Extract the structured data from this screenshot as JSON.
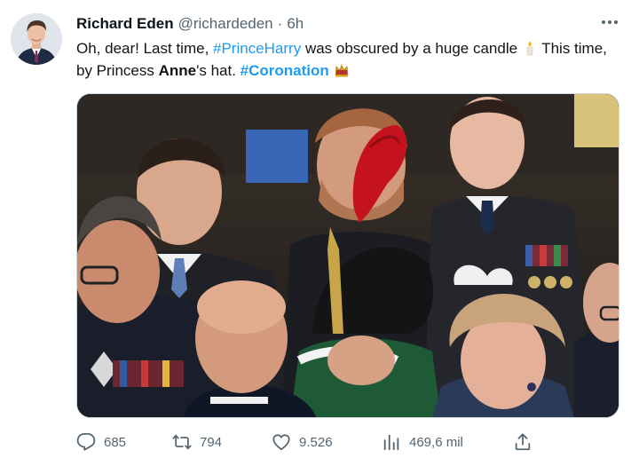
{
  "tweet": {
    "author_name": "Richard Eden",
    "handle": "@richardeden",
    "separator": "·",
    "time": "6h",
    "text": {
      "t1": "Oh, dear! Last time, ",
      "tag1": "#PrinceHarry",
      "t2": " was obscured by a huge candle ",
      "t3": " This time, by Princess ",
      "bold1": "Anne",
      "t4": "'s hat. ",
      "tag2": "#Coronation"
    },
    "emojis": [
      "candle-emoji",
      "crown-emoji"
    ]
  },
  "actions": {
    "replies": "685",
    "retweets": "794",
    "likes": "9.526",
    "views": "469,6 mil"
  },
  "icons": [
    "more-icon",
    "reply-icon",
    "retweet-icon",
    "like-icon",
    "views-icon",
    "share-icon"
  ],
  "colors": {
    "link": "#1d9bf0",
    "muted": "#536471",
    "text": "#0f1419",
    "border": "#cfd9de"
  }
}
